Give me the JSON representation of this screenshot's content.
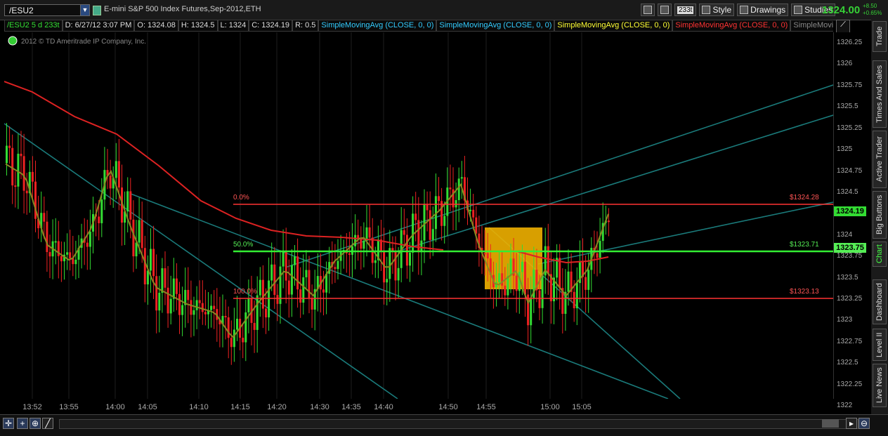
{
  "toolbar": {
    "symbol": "/ESU2",
    "title": "E-mini S&P 500 Index Futures,Sep-2012,ETH",
    "tick_badge": "233t",
    "style_label": "Style",
    "drawings_label": "Drawings",
    "studies_label": "Studies",
    "last_price": "1324.00",
    "change_abs": "+8.50",
    "change_pct": "+0.65%"
  },
  "infobar": {
    "symbol": "/ESU2 5 d 233t",
    "date": "D: 6/27/12 3:07 PM",
    "open": "O: 1324.08",
    "high": "H: 1324.5",
    "low": "L: 1324",
    "close": "C: 1324.19",
    "range": "R: 0.5",
    "studies": [
      {
        "label": "SimpleMovingAvg (CLOSE, 0, 0)",
        "color": "#33ccff"
      },
      {
        "label": "SimpleMovingAvg (CLOSE, 0, 0)",
        "color": "#33ccff"
      },
      {
        "label": "SimpleMovingAvg (CLOSE, 0, 0)",
        "color": "#ffff33"
      },
      {
        "label": "SimpleMovingAvg (CLOSE, 0, 0)",
        "color": "#ff3333"
      },
      {
        "label": "SimpleMoving...",
        "color": "#888888"
      }
    ]
  },
  "chart": {
    "copyright": "2012 © TD Ameritrade IP Company, Inc.",
    "fib_labels": {
      "zero": "0.0%",
      "fifty": "50.0%",
      "hundred": "100.0%"
    },
    "level_labels": {
      "high": "$1324.28",
      "mid": "$1323.71",
      "low": "$1323.13"
    },
    "price_boxes": {
      "current": "1324.19",
      "mid": "1323.75"
    }
  },
  "side_tabs": [
    "Trade",
    "Times And Sales",
    "Active Trader",
    "Big Buttons",
    "Chart",
    "Dashboard",
    "Level II",
    "Live News"
  ],
  "chart_data": {
    "type": "candlestick",
    "y_ticks": [
      "1326.25",
      "1326",
      "1325.75",
      "1325.5",
      "1325.25",
      "1325",
      "1324.75",
      "1324.5",
      "1324.25",
      "1324",
      "1323.75",
      "1323.5",
      "1323.25",
      "1323",
      "1322.75",
      "1322.5",
      "1322.25",
      "1322"
    ],
    "ylim": [
      1321.96,
      1326.25
    ],
    "x_ticks": [
      "13:52",
      "13:55",
      "14:00",
      "14:05",
      "14:10",
      "14:15",
      "14:20",
      "14:30",
      "14:35",
      "14:40",
      "14:50",
      "14:55",
      "15:00",
      "15:05"
    ],
    "levels": {
      "high": 1324.28,
      "mid": 1323.71,
      "low": 1323.13
    },
    "colors": {
      "up": "#33dd33",
      "down": "#ee2222",
      "sma_slow": "#dd2222",
      "sma_fast": "#888822",
      "trend": "#1a7a7a",
      "highlight": "#f0b000"
    }
  }
}
